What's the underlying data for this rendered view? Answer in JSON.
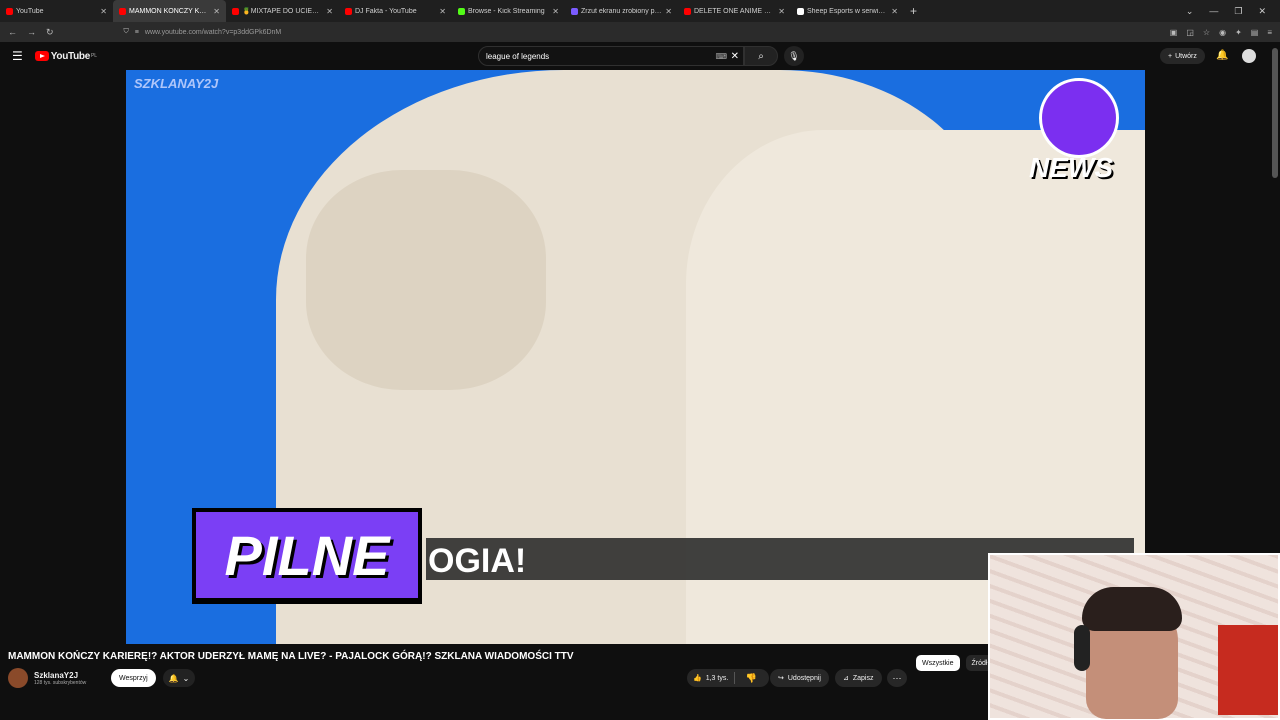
{
  "browser": {
    "tabs": [
      {
        "title": "YouTube",
        "fav": "#ff0000",
        "active": false
      },
      {
        "title": "MAMMON KOŃCZY KARIERĘ!? AKT",
        "fav": "#ff0000",
        "active": true
      },
      {
        "title": "🍍MIXTAPE DO UCIEKANIA P",
        "fav": "#ff0000",
        "active": false
      },
      {
        "title": "DJ Fakta - YouTube",
        "fav": "#ff0000",
        "active": false
      },
      {
        "title": "Browse - Kick Streaming",
        "fav": "#53fc18",
        "active": false
      },
      {
        "title": "Zrzut ekranu zrobiony przez Lig",
        "fav": "#7b5cff",
        "active": false
      },
      {
        "title": "DELETE ONE ANIME OPENING",
        "fav": "#ff0000",
        "active": false
      },
      {
        "title": "Sheep Esports w serwisie X: „SH",
        "fav": "#ffffff",
        "active": false
      }
    ],
    "new_tab": "+",
    "url": "www.youtube.com/watch?v=p3ddGPk6DnM"
  },
  "youtube": {
    "logo_text": "YouTube",
    "logo_region": "PL",
    "search_value": "league of legends",
    "create_label": "Utwórz"
  },
  "video": {
    "watermark": "SZKLANAY2J",
    "news_badge": "NEWS",
    "pilne": "PILNE",
    "lower_third": "OGIA!",
    "title": "MAMMON KOŃCZY KARIERĘ!? AKTOR UDERZYŁ MAMĘ NA LIVE? - PAJALOCK GÓRĄ!? SZKLANA WIADOMOŚCI TTV"
  },
  "channel": {
    "name": "SzklanaY2J",
    "subscribers": "128 tys. subskrybentów",
    "join_label": "Wesprzyj"
  },
  "actions": {
    "likes": "1,3 tys.",
    "share_label": "Udostępnij",
    "save_label": "Zapisz"
  },
  "chips": [
    "Wszystkie",
    "Źródł"
  ]
}
